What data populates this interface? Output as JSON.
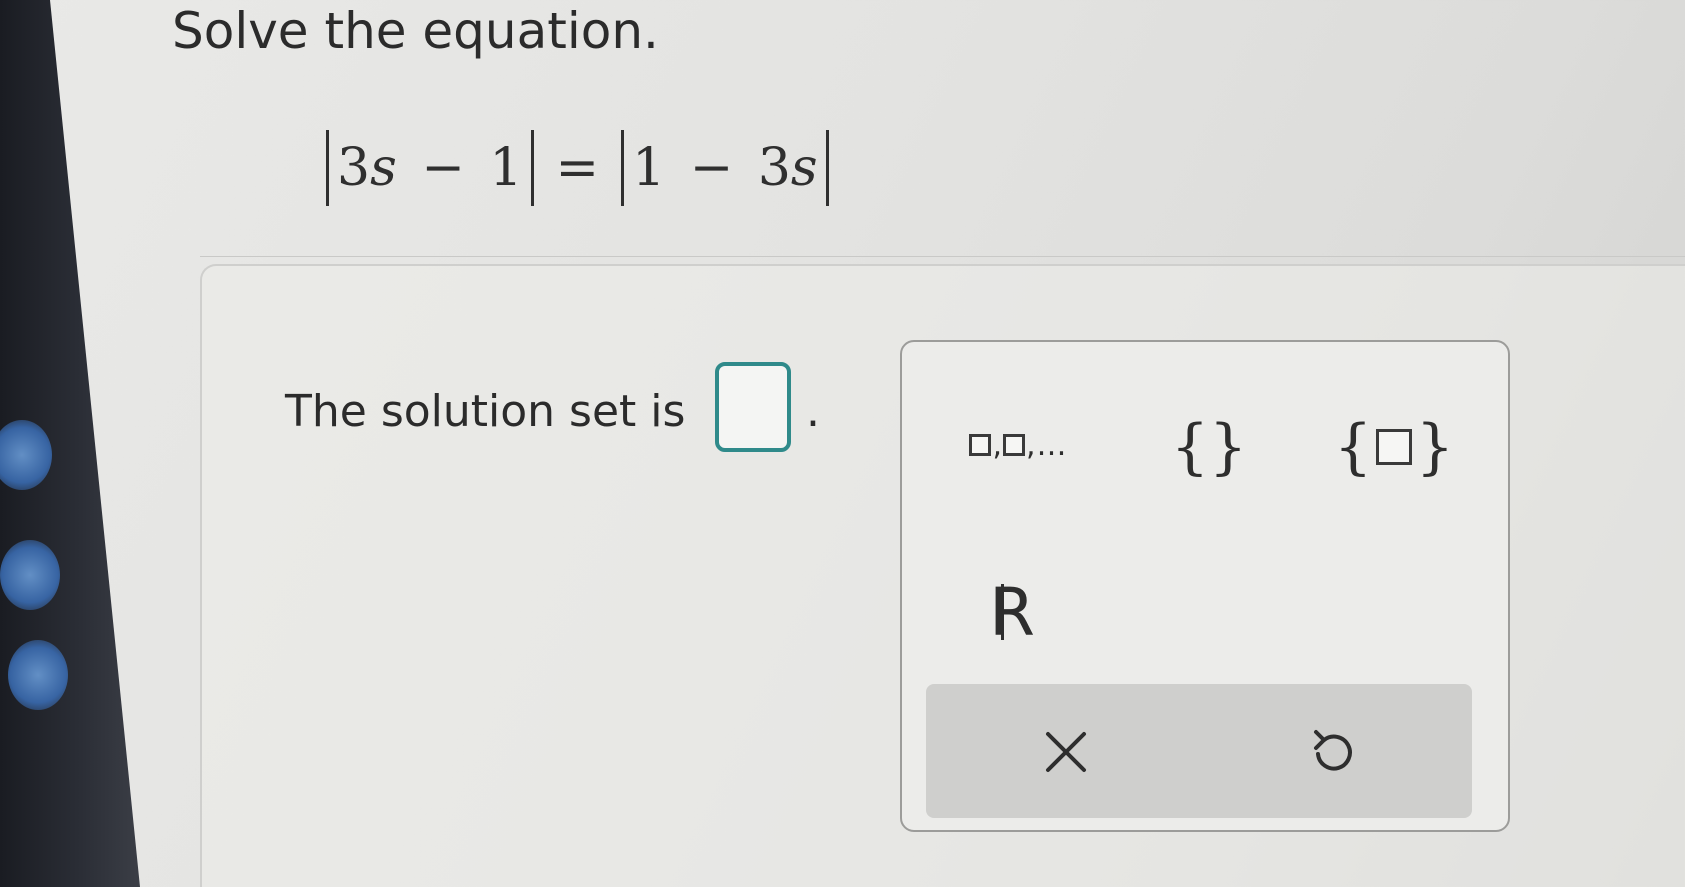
{
  "question": {
    "prompt": "Solve the equation.",
    "equation": {
      "left_abs": {
        "coef": "3",
        "var": "s",
        "op": "−",
        "const": "1"
      },
      "relation": "=",
      "right_abs": {
        "const": "1",
        "op": "−",
        "coef": "3",
        "var": "s"
      }
    }
  },
  "answer": {
    "label": "The solution set is",
    "value": "",
    "period": "."
  },
  "palette": {
    "list_separator": ",",
    "list_ellipsis": "…",
    "empty_set_open": "{",
    "empty_set_close": "}",
    "set_open": "{",
    "set_close": "}",
    "reals_letter": "R",
    "clear_label": "×"
  },
  "colors": {
    "answer_border": "#2f8a8a",
    "text": "#2b2b2b",
    "action_bar": "#cfcfcd"
  },
  "icons": {
    "clear": "close-icon",
    "undo": "undo-icon"
  }
}
